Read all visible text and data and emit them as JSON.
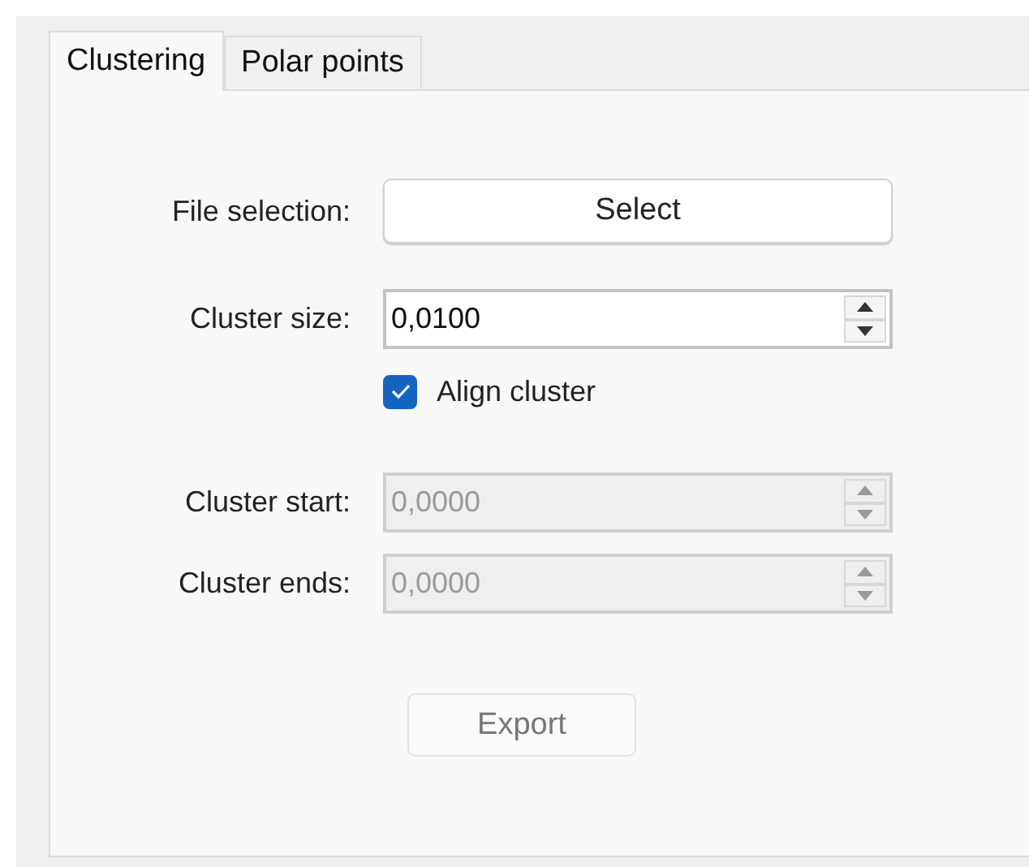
{
  "tabs": [
    {
      "label": "Clustering",
      "selected": true
    },
    {
      "label": "Polar points",
      "selected": false
    }
  ],
  "file_selection": {
    "label": "File selection:",
    "button": "Select"
  },
  "cluster_size": {
    "label": "Cluster size:",
    "value": "0,0100",
    "disabled": false
  },
  "align_cluster": {
    "label": "Align cluster",
    "checked": true
  },
  "cluster_start": {
    "label": "Cluster start:",
    "value": "0,0000",
    "disabled": true
  },
  "cluster_ends": {
    "label": "Cluster ends:",
    "value": "0,0000",
    "disabled": true
  },
  "export": {
    "label": "Export",
    "disabled": true
  }
}
